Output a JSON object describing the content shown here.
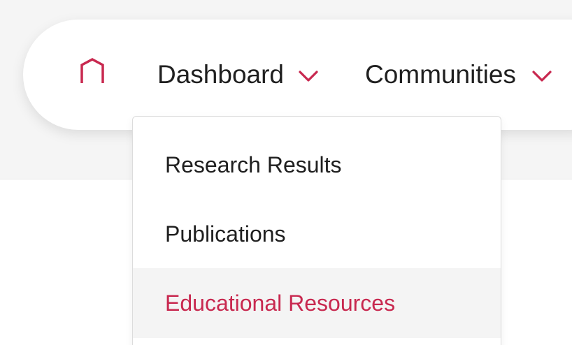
{
  "colors": {
    "accent": "#c8284f",
    "text": "#1f1f1f",
    "band_background": "#f5f5f5",
    "hover_background": "#f4f4f4"
  },
  "nav": {
    "home_icon": "home-arch-icon",
    "items": [
      {
        "label": "Dashboard",
        "icon": "chevron-down-icon",
        "expanded": true
      },
      {
        "label": "Communities",
        "icon": "chevron-down-icon",
        "expanded": false
      }
    ]
  },
  "dropdown": {
    "items": [
      {
        "label": "Research Results",
        "highlighted": false
      },
      {
        "label": "Publications",
        "highlighted": false
      },
      {
        "label": "Educational Resources",
        "highlighted": true
      }
    ]
  }
}
